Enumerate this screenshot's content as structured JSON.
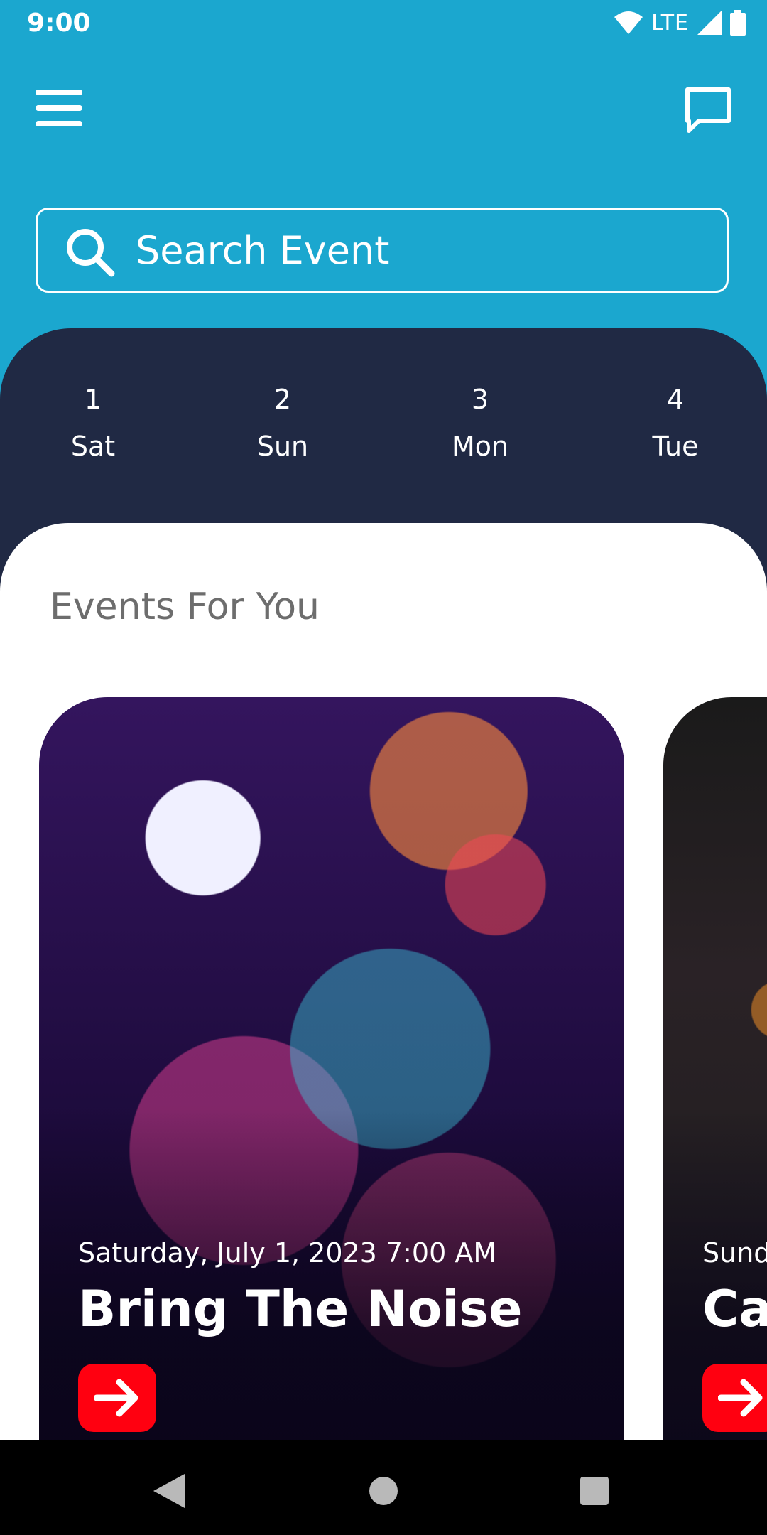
{
  "status_bar": {
    "time": "9:00",
    "network": "LTE",
    "icons": [
      "wifi-icon",
      "signal-icon",
      "battery-icon"
    ]
  },
  "app_bar": {
    "menu_icon": "hamburger-menu-icon",
    "chat_icon": "chat-bubble-icon"
  },
  "search": {
    "placeholder": "Search Event",
    "icon": "search-icon"
  },
  "dates": [
    {
      "num": "1",
      "day": "Sat"
    },
    {
      "num": "2",
      "day": "Sun"
    },
    {
      "num": "3",
      "day": "Mon"
    },
    {
      "num": "4",
      "day": "Tue"
    }
  ],
  "section": {
    "title": "Events For You"
  },
  "events": [
    {
      "date": "Saturday, July 1, 2023 7:00 AM",
      "title": "Bring The Noise"
    },
    {
      "date": "Sunday",
      "title": "Ca"
    }
  ],
  "colors": {
    "primary": "#1ba7cf",
    "dark_panel": "#202944",
    "accent_red": "#ff0010",
    "section_title": "#6d6d6d"
  }
}
